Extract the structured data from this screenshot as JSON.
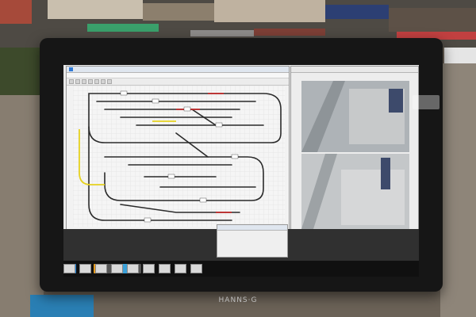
{
  "scene": {
    "description_colors": {
      "room_wall": "#6b6257",
      "monitor_bezel": "#161616",
      "screen_background": "#e9e9e9",
      "track_line": "#2b2b2b",
      "track_highlight_yellow": "#e6d21f",
      "track_highlight_red": "#c22b2b",
      "grid_line": "#dcdcdc",
      "app_brand_blue": "#1f3f77"
    }
  },
  "windows": {
    "track_plan": {
      "title": "",
      "brand": "",
      "menu_items": []
    },
    "camera_view": {
      "title": ""
    },
    "dialog": {
      "brand": ""
    }
  },
  "bezel": {
    "logo_text": "HANNS·G"
  }
}
